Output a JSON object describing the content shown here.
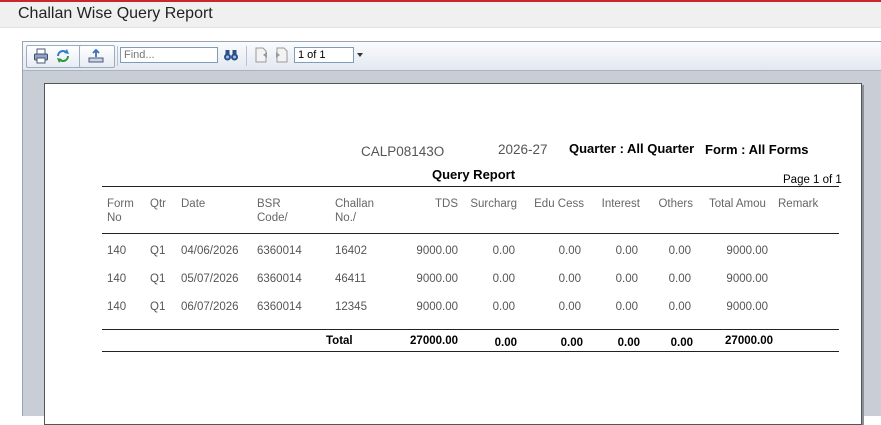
{
  "window": {
    "title": "Challan Wise Query Report"
  },
  "toolbar": {
    "find_placeholder": "Find...",
    "page_value": "1 of 1",
    "icons": [
      "print-icon",
      "refresh-icon",
      "export-icon",
      "find-binoculars-icon",
      "prev-page-icon",
      "next-page-icon"
    ]
  },
  "report": {
    "code": "CALP08143O",
    "year": "2026-27",
    "quarter_label": "Quarter :  All Quarter",
    "form_label": "Form :   All Forms",
    "title": "Query  Report",
    "page": "Page 1 of 1",
    "columns": [
      {
        "line1": "Form",
        "line2": "No"
      },
      {
        "line1": "Qtr",
        "line2": ""
      },
      {
        "line1": "Date",
        "line2": ""
      },
      {
        "line1": "BSR",
        "line2": "Code/"
      },
      {
        "line1": "Challan",
        "line2": "No./"
      },
      {
        "line1": "TDS",
        "line2": ""
      },
      {
        "line1": "Surcharg",
        "line2": ""
      },
      {
        "line1": "Edu Cess",
        "line2": ""
      },
      {
        "line1": "Interest",
        "line2": ""
      },
      {
        "line1": "Others",
        "line2": ""
      },
      {
        "line1": "Total Amou",
        "line2": ""
      },
      {
        "line1": "Remark",
        "line2": ""
      }
    ],
    "rows": [
      [
        "140",
        "Q1",
        "04/06/2026",
        "6360014",
        "16402",
        "9000.00",
        "0.00",
        "0.00",
        "0.00",
        "0.00",
        "9000.00",
        ""
      ],
      [
        "140",
        "Q1",
        "05/07/2026",
        "6360014",
        "46411",
        "9000.00",
        "0.00",
        "0.00",
        "0.00",
        "0.00",
        "9000.00",
        ""
      ],
      [
        "140",
        "Q1",
        "06/07/2026",
        "6360014",
        "12345",
        "9000.00",
        "0.00",
        "0.00",
        "0.00",
        "0.00",
        "9000.00",
        ""
      ]
    ],
    "totals": {
      "label": "Total",
      "tds": "27000.00",
      "surcharge": "0.00",
      "edu_cess": "0.00",
      "interest": "0.00",
      "others": "0.00",
      "total_amount": "27000.00"
    }
  }
}
